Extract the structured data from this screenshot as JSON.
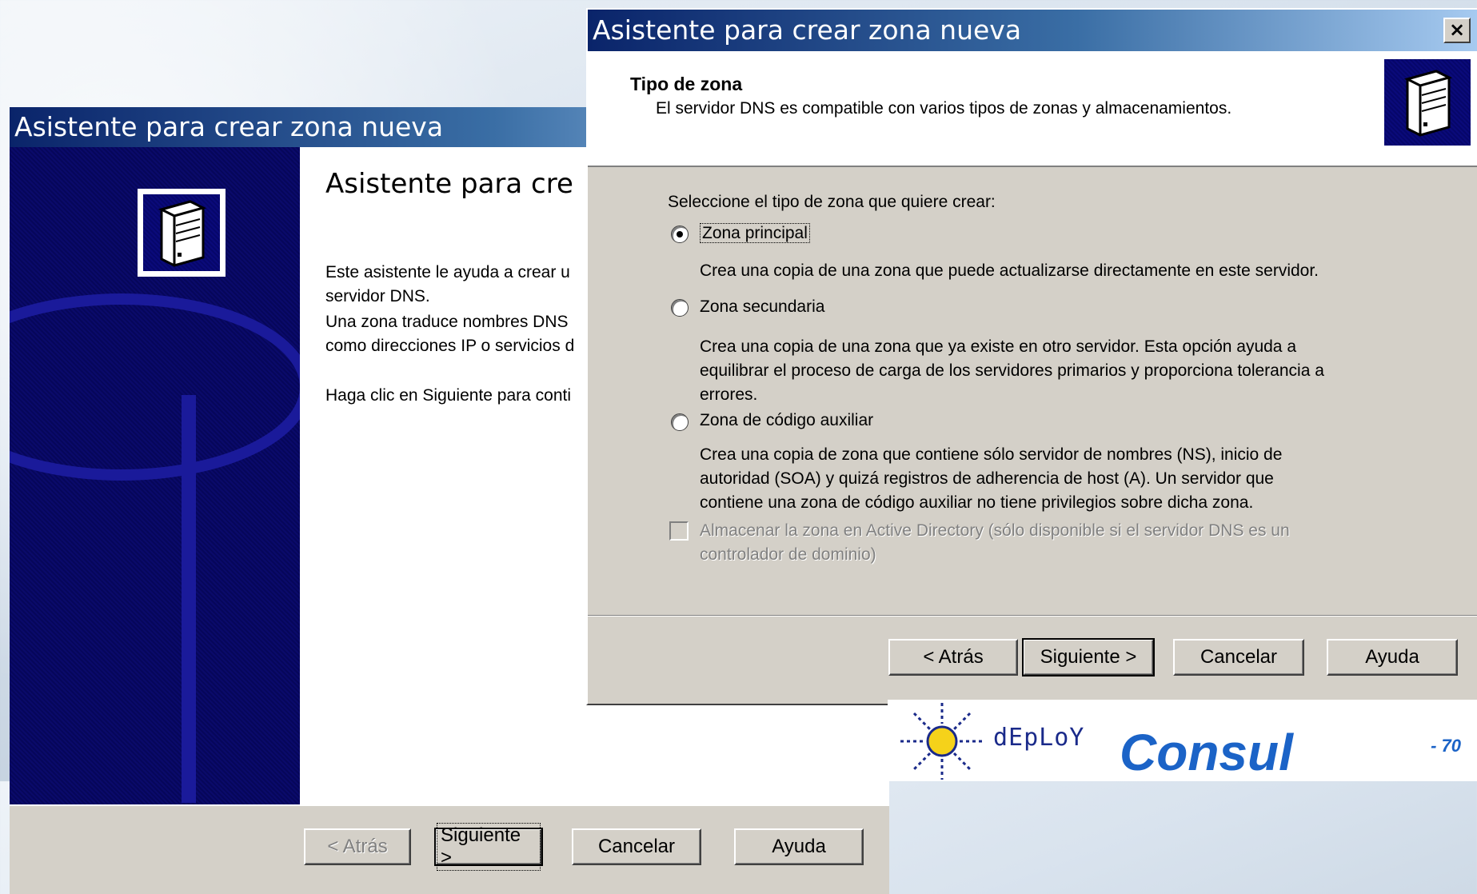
{
  "back_window": {
    "title": "Asistente para crear zona nueva",
    "heading": "Asistente para cre",
    "paragraph1": "Este asistente le ayuda a crear u servidor DNS.",
    "paragraph1_line1": "Este asistente le ayuda a crear u",
    "paragraph1_line2": "servidor DNS.",
    "paragraph2_line1": "Una zona traduce nombres DNS",
    "paragraph2_line2": "como direcciones IP o servicios d",
    "paragraph3": "Haga clic en Siguiente para conti",
    "buttons": {
      "back": "< Atrás",
      "next": "Siguiente >",
      "cancel": "Cancelar",
      "help": "Ayuda"
    }
  },
  "front_window": {
    "title": "Asistente para crear zona nueva",
    "close_label": "×",
    "header": {
      "title": "Tipo de zona",
      "subtitle": "El servidor DNS es compatible con varios tipos de zonas y almacenamientos."
    },
    "prompt": "Seleccione el tipo de zona que quiere crear:",
    "options": [
      {
        "label": "Zona principal",
        "selected": true,
        "description": "Crea una copia de una zona que puede actualizarse directamente en este servidor."
      },
      {
        "label": "Zona secundaria",
        "selected": false,
        "description_lines": [
          "Crea una copia de una zona que ya existe en otro servidor. Esta opción ayuda a",
          "equilibrar el proceso de carga de los servidores primarios y proporciona tolerancia a",
          "errores."
        ]
      },
      {
        "label": "Zona de código auxiliar",
        "selected": false,
        "description_lines": [
          "Crea una copia de zona que contiene sólo servidor de nombres (NS), inicio de",
          "autoridad (SOA) y quizá registros de adherencia de host (A). Un servidor que",
          "contiene una zona de código auxiliar no tiene privilegios sobre dicha zona."
        ]
      }
    ],
    "ad_checkbox": {
      "line1": "Almacenar la zona en Active Directory (sólo disponible si el servidor DNS es un",
      "line2": "controlador de dominio)",
      "checked": false,
      "enabled": false
    },
    "buttons": {
      "back": "< Atrás",
      "next": "Siguiente >",
      "cancel": "Cancelar",
      "help": "Ayuda"
    }
  },
  "branding": {
    "deploy": "dEpLoY",
    "consul": "Consul",
    "page_number": "- 70"
  },
  "colors": {
    "title_bar_start": "#0a246a",
    "title_bar_end": "#a6caf0",
    "dialog_face": "#d4d0c8",
    "brand_blue": "#1b63c7"
  }
}
